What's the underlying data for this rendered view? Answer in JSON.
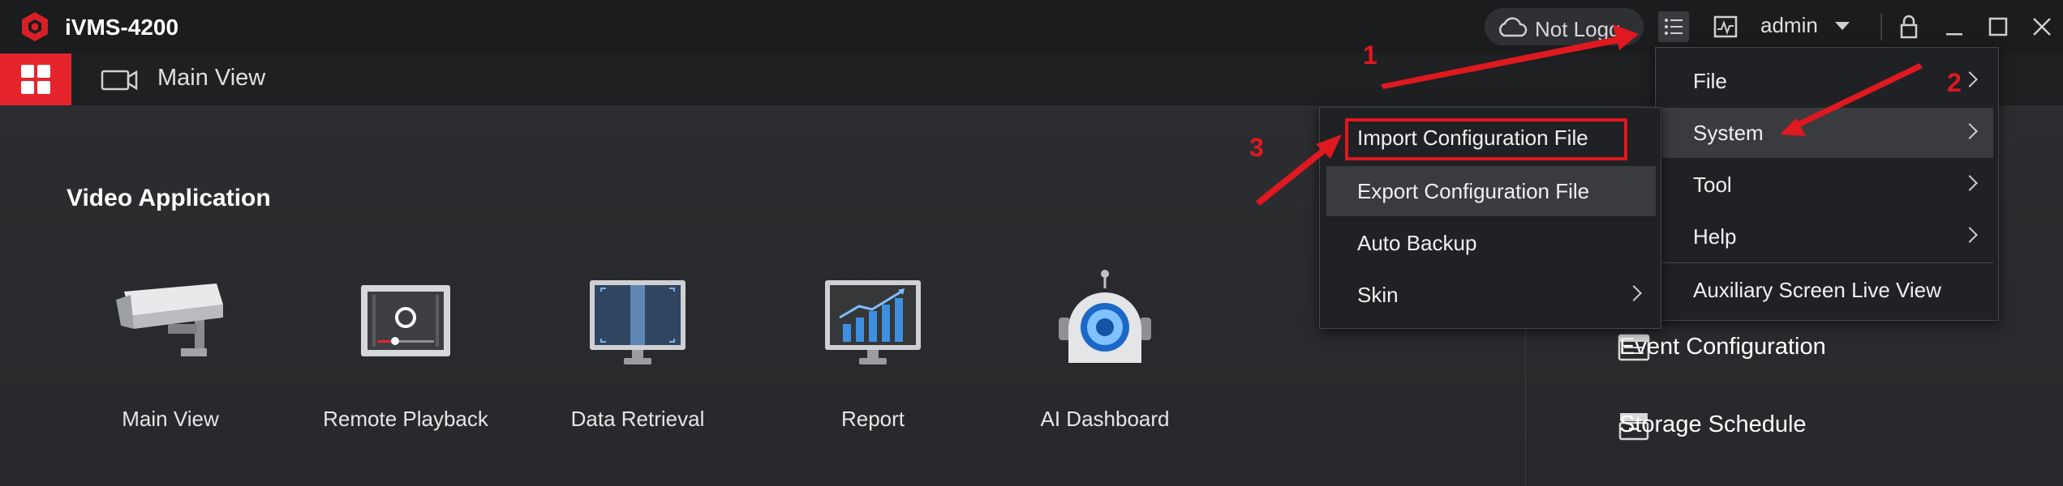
{
  "app": {
    "title": "iVMS-4200"
  },
  "titlebar": {
    "cloud_status": "Not Logg...",
    "user": "admin",
    "icons": [
      "cloud-icon",
      "menu-list-icon",
      "monitor-icon",
      "user-caret-icon",
      "lock-icon",
      "minimize-icon",
      "maximize-icon",
      "close-icon"
    ]
  },
  "tabs": {
    "home_icon": "grid-icon",
    "main_view_label": "Main View"
  },
  "section": {
    "title": "Video Application",
    "apps": [
      {
        "label": "Main View",
        "icon": "camera-icon"
      },
      {
        "label": "Remote Playback",
        "icon": "playback-icon"
      },
      {
        "label": "Data Retrieval",
        "icon": "data-retrieval-icon"
      },
      {
        "label": "Report",
        "icon": "report-chart-icon"
      },
      {
        "label": "AI Dashboard",
        "icon": "ai-robot-icon"
      }
    ]
  },
  "right_panel": {
    "items": [
      {
        "label": "Event Configuration",
        "icon": "event-config-icon"
      },
      {
        "label": "Storage Schedule",
        "icon": "storage-icon"
      }
    ]
  },
  "main_menu": {
    "items": [
      {
        "label": "File",
        "has_submenu": true
      },
      {
        "label": "System",
        "has_submenu": true,
        "highlighted": true
      },
      {
        "label": "Tool",
        "has_submenu": true
      },
      {
        "label": "Help",
        "has_submenu": true
      },
      {
        "label": "Auxiliary Screen Live View",
        "has_submenu": false
      }
    ]
  },
  "system_submenu": {
    "items": [
      {
        "label": "Import Configuration File",
        "has_submenu": false,
        "boxed": true
      },
      {
        "label": "Export Configuration File",
        "has_submenu": false,
        "highlighted": true
      },
      {
        "label": "Auto Backup",
        "has_submenu": false
      },
      {
        "label": "Skin",
        "has_submenu": true
      }
    ]
  },
  "annotations": {
    "steps": [
      "1",
      "2",
      "3"
    ],
    "color": "#e0181f"
  },
  "colors": {
    "accent_red": "#e5242c",
    "titlebar": "#1b1c1e",
    "content_bg": "#2a2b2e"
  }
}
